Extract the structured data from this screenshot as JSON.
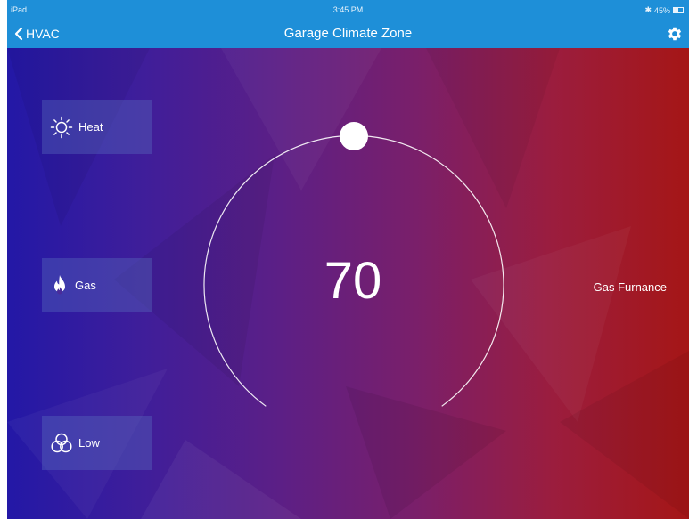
{
  "status_bar": {
    "device": "iPad",
    "time": "3:45 PM",
    "battery": "45%"
  },
  "nav": {
    "back_label": "HVAC",
    "title": "Garage Climate Zone"
  },
  "modes": [
    {
      "label": "Heat",
      "icon": "sun-icon"
    },
    {
      "label": "Gas",
      "icon": "flame-icon"
    },
    {
      "label": "Low",
      "icon": "fan-icon"
    }
  ],
  "thermostat": {
    "setpoint": "70"
  },
  "equipment": {
    "label": "Gas Furnance"
  },
  "colors": {
    "nav_bar": "#1e8fd8",
    "gradient_left": "#2318a6",
    "gradient_right": "#a51616"
  }
}
